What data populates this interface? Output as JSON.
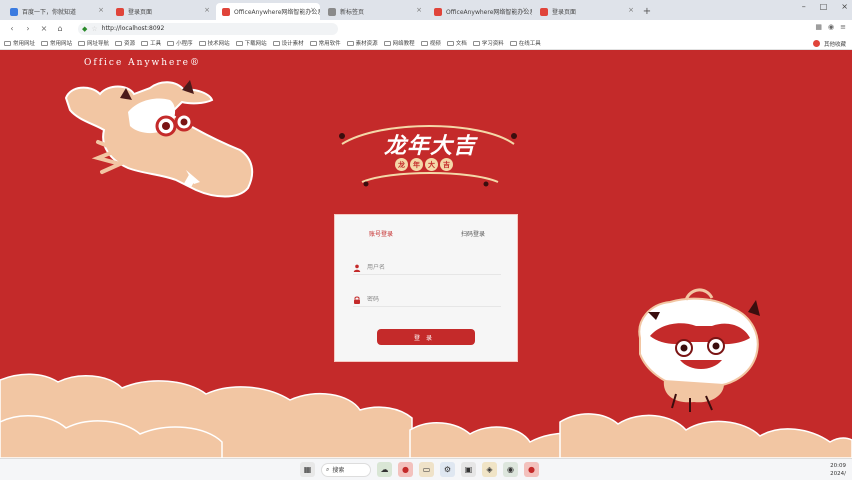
{
  "browser": {
    "tabs": [
      {
        "label": "百度一下，你就知道",
        "active": false
      },
      {
        "label": "登录页面",
        "active": false
      },
      {
        "label": "OfficeAnywhere网络智能办公系统",
        "active": true
      },
      {
        "label": "新标签页",
        "active": false
      },
      {
        "label": "OfficeAnywhere网络智能办公系统",
        "active": false
      },
      {
        "label": "登录页面",
        "active": false
      }
    ],
    "new_tab_label": "+",
    "window_controls": [
      "–",
      "□",
      "×"
    ],
    "address": "http://localhost:8092",
    "bookmarks": [
      "常用网址",
      "常用网站",
      "网址导航",
      "资源",
      "工具",
      "小程序",
      "技术网站",
      "下载网站",
      "设计素材",
      "常用软件",
      "素材资源",
      "网络教程",
      "视频",
      "文档",
      "学习资料",
      "在线工具"
    ],
    "bookmarks_right": "其他收藏"
  },
  "page": {
    "brand": "Office Anywhere®",
    "hero_title": "龙年大吉",
    "hero_sub": [
      "龙",
      "年",
      "大",
      "吉"
    ]
  },
  "login": {
    "tab_account": "账号登录",
    "tab_qrcode": "扫码登录",
    "username_placeholder": "用户名",
    "password_placeholder": "密码",
    "button": "登录"
  },
  "taskbar": {
    "search_label": "搜索",
    "time": "20:09",
    "date": "2024/"
  },
  "colors": {
    "page_bg": "#c42a2a",
    "card_bg": "#f6f6f6",
    "accent": "#c42a2a",
    "cloud": "#f2c6a3"
  }
}
